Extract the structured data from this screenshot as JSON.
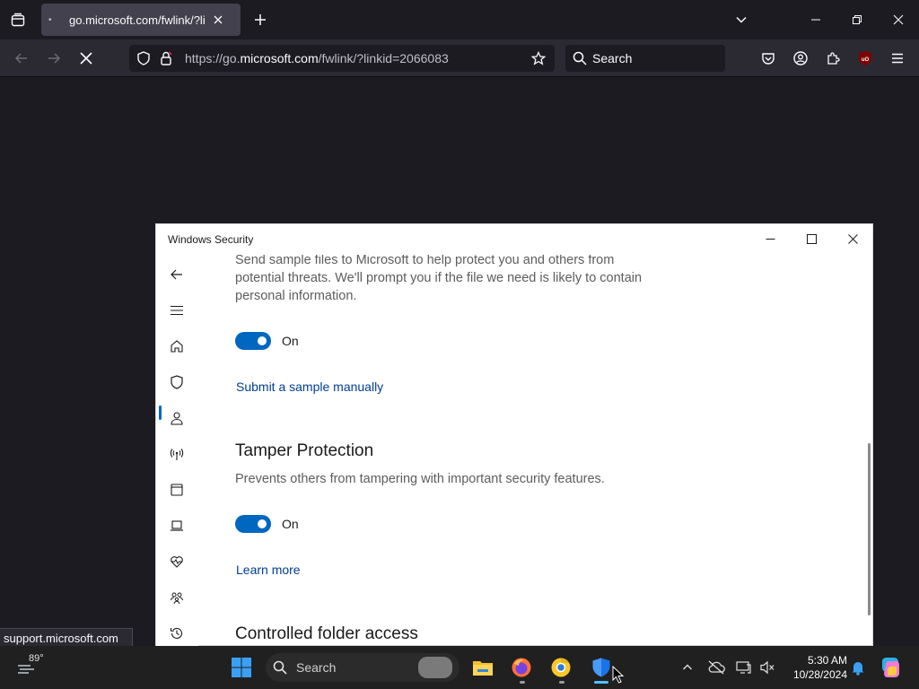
{
  "browser": {
    "tab": {
      "title": "go.microsoft.com/fwlink/?linkid=2066083"
    },
    "urlbar": {
      "url_prefix": "https://go.",
      "url_domain": "microsoft.com",
      "url_path": "/fwlink/?linkid=2066083"
    },
    "search": {
      "placeholder": "Search"
    },
    "status_text": "support.microsoft.com"
  },
  "dialog": {
    "title": "Windows Security",
    "sample_desc_lines": [
      "Send sample files to Microsoft to help protect you and others from",
      "potential threats. We'll prompt you if the file we need is likely to contain",
      "personal information."
    ],
    "sample_toggle_label": "On",
    "submit_link": "Submit a sample manually",
    "tamper_heading": "Tamper Protection",
    "tamper_desc": "Prevents others from tampering with important security features.",
    "tamper_toggle_label": "On",
    "learn_more": "Learn more",
    "cfa_heading": "Controlled folder access",
    "nav_icons": [
      "back-icon",
      "menu-icon",
      "home-icon",
      "shield-icon",
      "person-icon",
      "wifi-icon",
      "browser-icon",
      "laptop-icon",
      "heart-icon",
      "family-icon",
      "history-icon"
    ],
    "accent": "#0067c0",
    "link_color": "#003e92"
  },
  "taskbar": {
    "weather_temp": "89°",
    "search_label": "Search",
    "time": "5:30 AM",
    "date": "10/28/2024"
  }
}
